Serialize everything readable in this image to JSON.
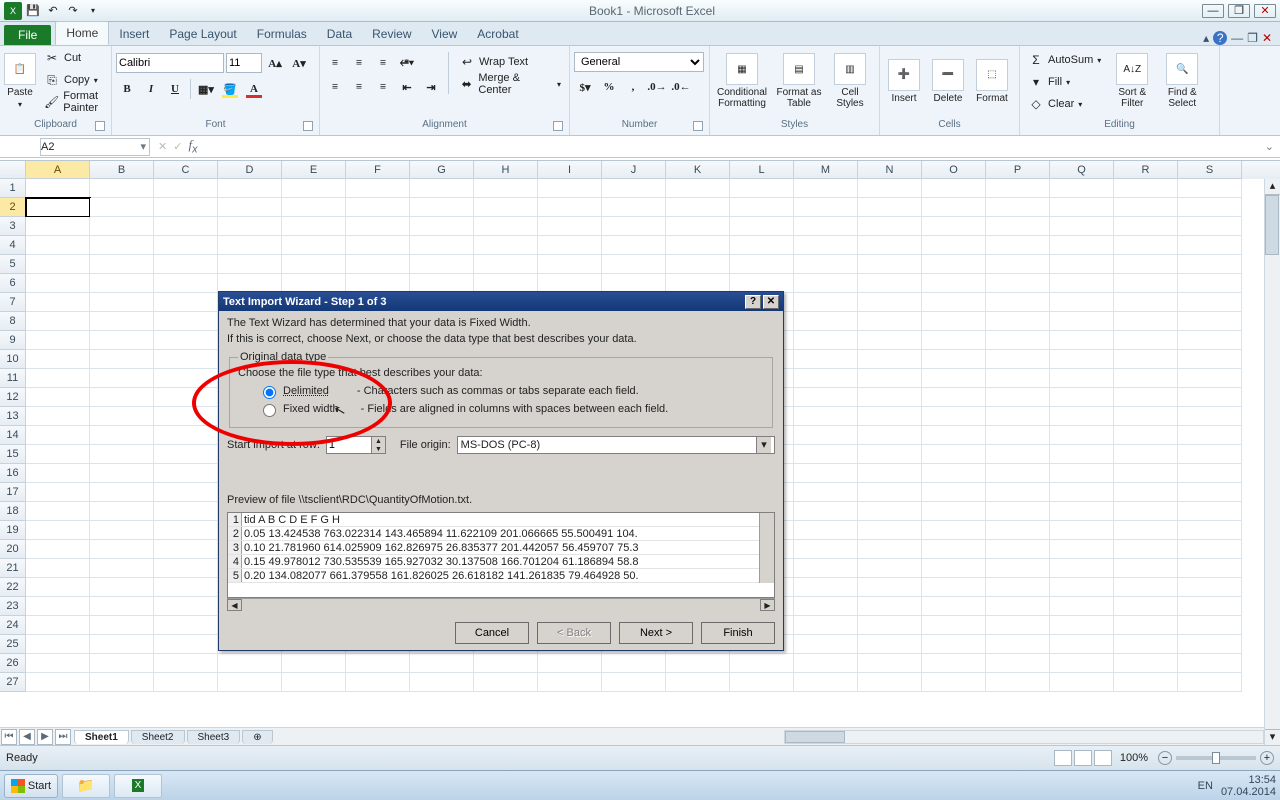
{
  "title": "Book1 - Microsoft Excel",
  "qat": {
    "save": "💾",
    "undo": "↶",
    "redo": "↷",
    "dd": "▾"
  },
  "winctl": {
    "min": "—",
    "restore": "❐",
    "close": "✕"
  },
  "tabs": {
    "file": "File",
    "home": "Home",
    "insert": "Insert",
    "pagelayout": "Page Layout",
    "formulas": "Formulas",
    "data": "Data",
    "review": "Review",
    "view": "View",
    "acrobat": "Acrobat",
    "help": "?",
    "min": "▴"
  },
  "ribbon": {
    "clipboard": {
      "paste": "Paste",
      "cut": "Cut",
      "copy": "Copy",
      "fp": "Format Painter",
      "label": "Clipboard"
    },
    "font": {
      "name": "Calibri",
      "size": "11",
      "label": "Font",
      "bold": "B",
      "italic": "I",
      "underline": "U"
    },
    "alignment": {
      "wrap": "Wrap Text",
      "merge": "Merge & Center",
      "label": "Alignment"
    },
    "number": {
      "general": "General",
      "label": "Number"
    },
    "styles": {
      "cf": "Conditional Formatting",
      "fat": "Format as Table",
      "cs": "Cell Styles",
      "label": "Styles"
    },
    "cells": {
      "ins": "Insert",
      "del": "Delete",
      "fmt": "Format",
      "label": "Cells"
    },
    "editing": {
      "as": "AutoSum",
      "fill": "Fill",
      "clear": "Clear",
      "sort": "Sort & Filter",
      "find": "Find & Select",
      "label": "Editing"
    }
  },
  "namebox": "A2",
  "fx": "",
  "columns": [
    "A",
    "B",
    "C",
    "D",
    "E",
    "F",
    "G",
    "H",
    "I",
    "J",
    "K",
    "L",
    "M",
    "N",
    "O",
    "P",
    "Q",
    "R",
    "S"
  ],
  "rownums": [
    1,
    2,
    3,
    4,
    5,
    6,
    7,
    8,
    9,
    10,
    11,
    12,
    13,
    14,
    15,
    16,
    17,
    18,
    19,
    20,
    21,
    22,
    23,
    24,
    25,
    26,
    27
  ],
  "sheets": {
    "s1": "Sheet1",
    "s2": "Sheet2",
    "s3": "Sheet3",
    "new": "⊕"
  },
  "status": {
    "ready": "Ready",
    "zoom": "100%"
  },
  "dialog": {
    "title": "Text Import Wizard - Step 1 of 3",
    "line1": "The Text Wizard has determined that your data is Fixed Width.",
    "line2": "If this is correct, choose Next, or choose the data type that best describes your data.",
    "grouptitle": "Original data type",
    "choose": "Choose the file type that best describes your data:",
    "delimited": "Delimited",
    "delimited_desc": "- Characters such as commas or tabs separate each field.",
    "fixed": "Fixed width",
    "fixed_desc": "- Fields are aligned in columns with spaces between each field.",
    "startrow_label": "Start import at row:",
    "startrow_val": "1",
    "origin_label": "File origin:",
    "origin_val": "MS-DOS (PC-8)",
    "preview_label": "Preview of file \\\\tsclient\\RDC\\QuantityOfMotion.txt.",
    "preview_rows": [
      "tid A B C D E F G H",
      "0.05 13.424538 763.022314 143.465894 11.622109 201.066665 55.500491 104.",
      "0.10 21.781960 614.025909 162.826975 26.835377 201.442057 56.459707 75.3",
      "0.15 49.978012 730.535539 165.927032 30.137508 166.701204 61.186894 58.8",
      "0.20 134.082077 661.379558 161.826025 26.618182 141.261835 79.464928 50."
    ],
    "cancel": "Cancel",
    "back": "< Back",
    "next": "Next >",
    "finish": "Finish"
  },
  "task": {
    "start": "Start",
    "lang": "EN",
    "time": "13:54",
    "date": "07.04.2014"
  }
}
